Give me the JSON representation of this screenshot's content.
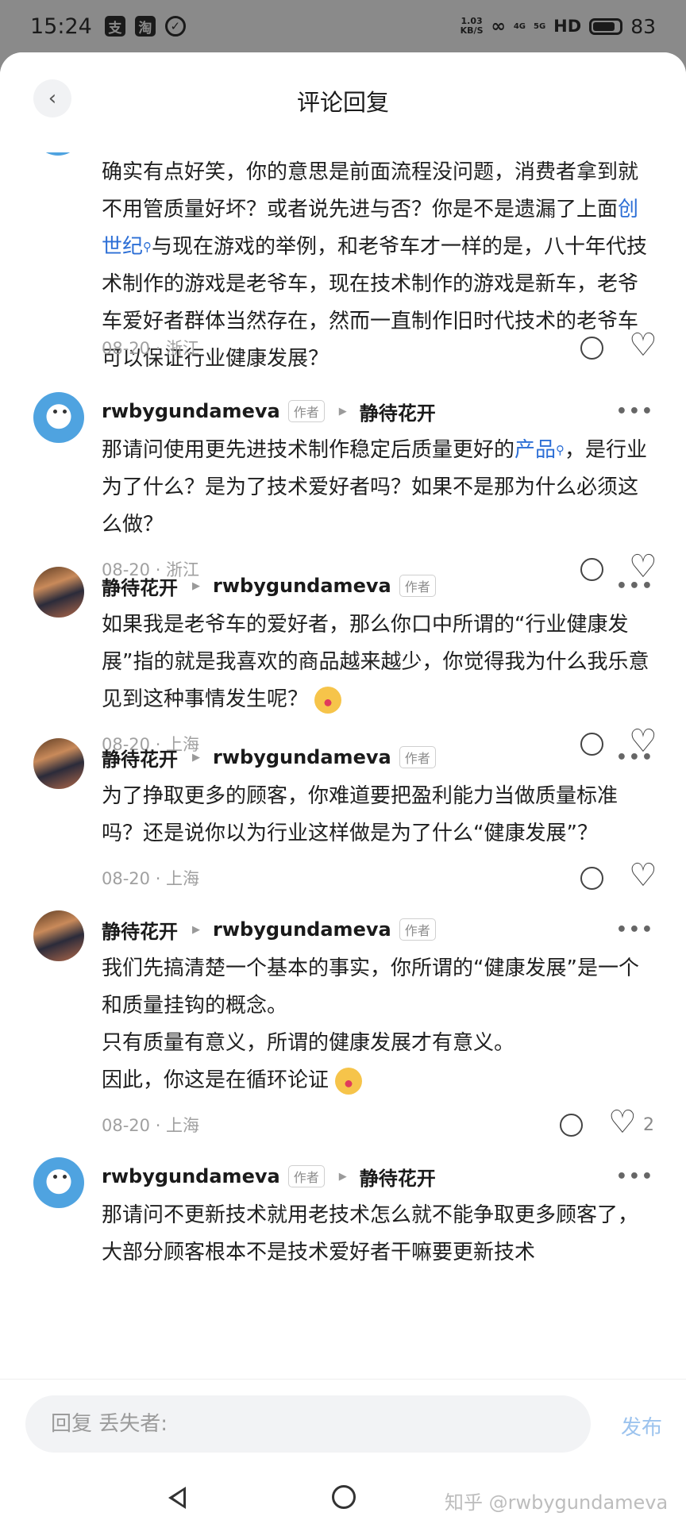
{
  "status_bar": {
    "time": "15:24",
    "app_icons": [
      "支",
      "淘"
    ],
    "net_speed": "1.03\nKB/S",
    "signal_1": "4G",
    "signal_2": "5G",
    "hd": "HD",
    "battery": "83",
    "battery_level": 0.83
  },
  "header": {
    "back_icon": "chevron-left-icon",
    "title": "评论回复"
  },
  "partial_comment": {
    "text_parts": [
      "确实有点好笑，你的意思是前面流程没问题，消费者拿到就不用管质量好坏？或者说先进与否？你是不是遗漏了上面",
      "创世纪",
      "与现在游戏的举例，和老爷车才一样的是，八十年代技术制作的游戏是老爷车，现在技术制作的游戏是新车，老爷车爱好者群体当然存在，然而一直制作旧时代技术的老爷车可以保证行业健康发展？"
    ],
    "meta": "08-20 · 浙江"
  },
  "comments": [
    {
      "author": "rwbygundameva",
      "author_tag": "作者",
      "reply_to": "静待花开",
      "reply_to_tag": "",
      "avatar": "blue",
      "text_parts": [
        "那请问使用更先进技术制作稳定后质量更好的",
        "产品",
        "，是行业为了什么？是为了技术爱好者吗？如果不是那为什么必须这么做？"
      ],
      "meta": "08-20 · 浙江",
      "likes": ""
    },
    {
      "author": "静待花开",
      "author_tag": "",
      "reply_to": "rwbygundameva",
      "reply_to_tag": "作者",
      "avatar": "anime",
      "text_parts": [
        "如果我是老爷车的爱好者，那么你口中所谓的“行业健康发展”指的就是我喜欢的商品越来越少，你觉得我为什么我乐意见到这种事情发生呢？"
      ],
      "emoji": true,
      "meta": "08-20 · 上海",
      "likes": ""
    },
    {
      "author": "静待花开",
      "author_tag": "",
      "reply_to": "rwbygundameva",
      "reply_to_tag": "作者",
      "avatar": "anime",
      "text_parts": [
        "为了挣取更多的顾客，你难道要把盈利能力当做质量标准吗？还是说你以为行业这样做是为了什么“健康发展”？"
      ],
      "meta": "08-20 · 上海",
      "likes": ""
    },
    {
      "author": "静待花开",
      "author_tag": "",
      "reply_to": "rwbygundameva",
      "reply_to_tag": "作者",
      "avatar": "anime",
      "text_parts": [
        "我们先搞清楚一个基本的事实，你所谓的“健康发展”是一个和质量挂钩的概念。\n只有质量有意义，所谓的健康发展才有意义。\n因此，你这是在循环论证"
      ],
      "emoji": true,
      "meta": "08-20 · 上海",
      "likes": "2"
    },
    {
      "author": "rwbygundameva",
      "author_tag": "作者",
      "reply_to": "静待花开",
      "reply_to_tag": "",
      "avatar": "blue",
      "text_parts": [
        "那请问不更新技术就用老技术怎么就不能争取更多顾客了，大部分顾客根本不是技术爱好者干嘛要更新技术"
      ],
      "meta": "",
      "likes": ""
    }
  ],
  "reply_bar": {
    "placeholder": "回复 丢失者:",
    "publish": "发布"
  },
  "nav": {
    "watermark": "知乎 @rwbygundameva"
  }
}
